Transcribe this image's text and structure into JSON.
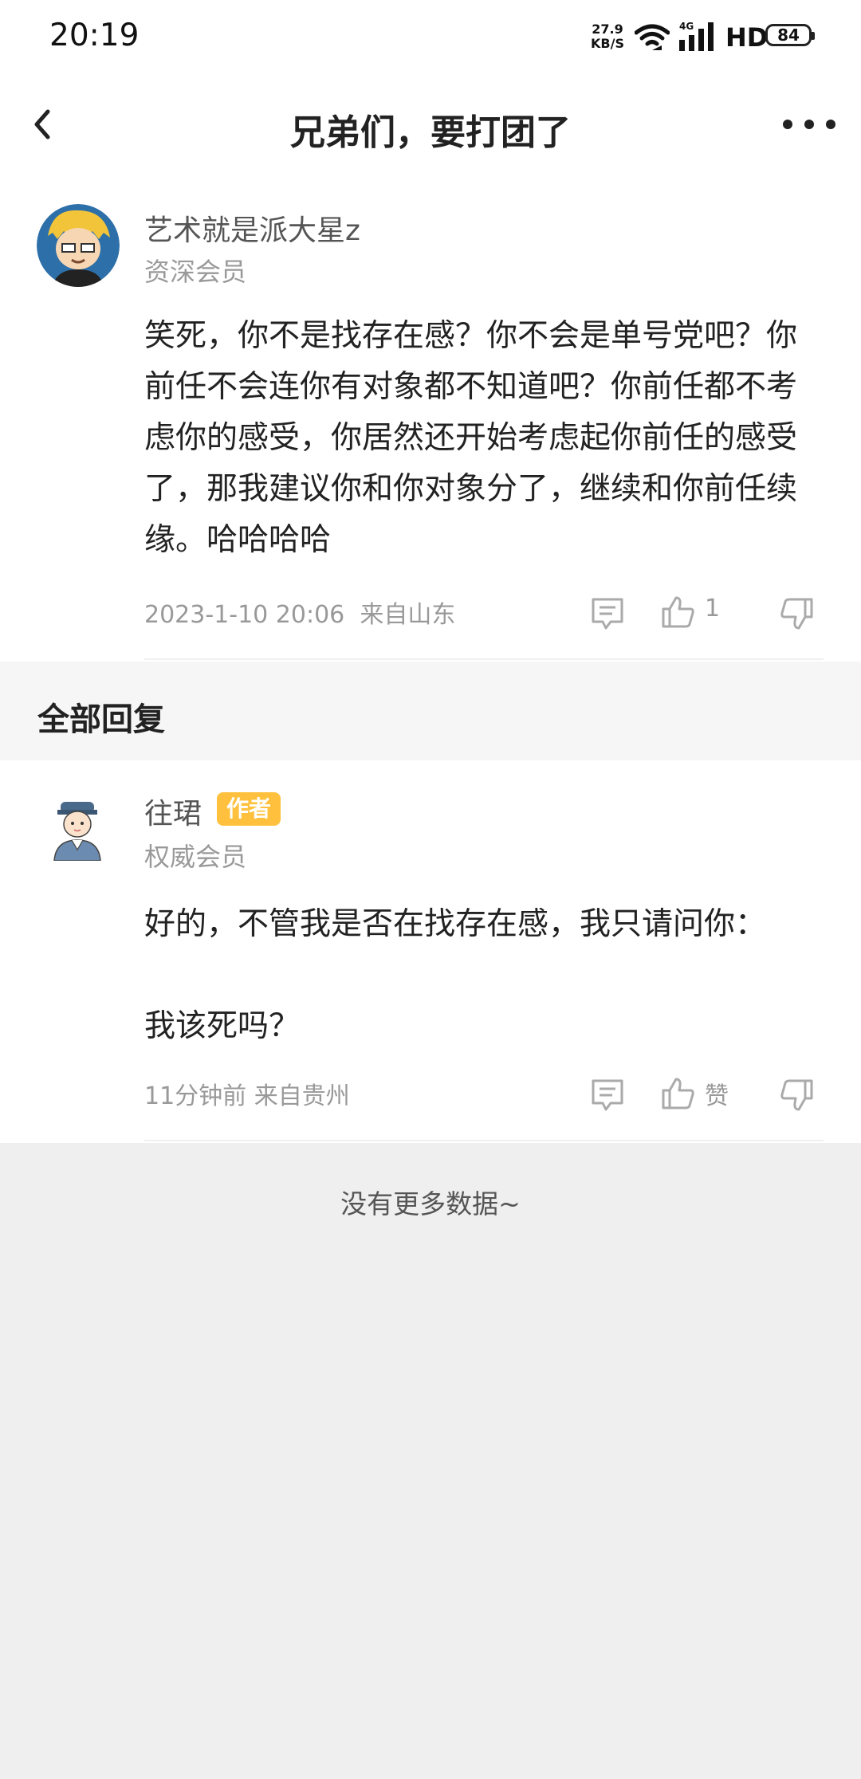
{
  "status_bar": {
    "time": "20:19",
    "net_speed_value": "27.9",
    "net_speed_unit": "KB/S",
    "network": "4G",
    "hd": "HD",
    "battery": "84"
  },
  "nav": {
    "title": "兄弟们，要打团了"
  },
  "comment": {
    "username": "艺术就是派大星z",
    "member_level": "资深会员",
    "text": "笑死，你不是找存在感？你不会是单号党吧？你前任不会连你有对象都不知道吧？你前任都不考虑你的感受，你居然还开始考虑起你前任的感受了，那我建议你和你对象分了，继续和你前任续缘。哈哈哈哈",
    "timestamp": "2023-1-10 20:06",
    "location": "来自山东",
    "like_count": "1"
  },
  "replies_section": {
    "title": "全部回复"
  },
  "reply": {
    "username": "往珺",
    "badge": "作者",
    "member_level": "权威会员",
    "text": "好的，不管我是否在找存在感，我只请问你：\n\n我该死吗？",
    "timestamp": "11分钟前",
    "location": "来自贵州",
    "like_label": "赞"
  },
  "footer": {
    "no_more": "没有更多数据~"
  }
}
